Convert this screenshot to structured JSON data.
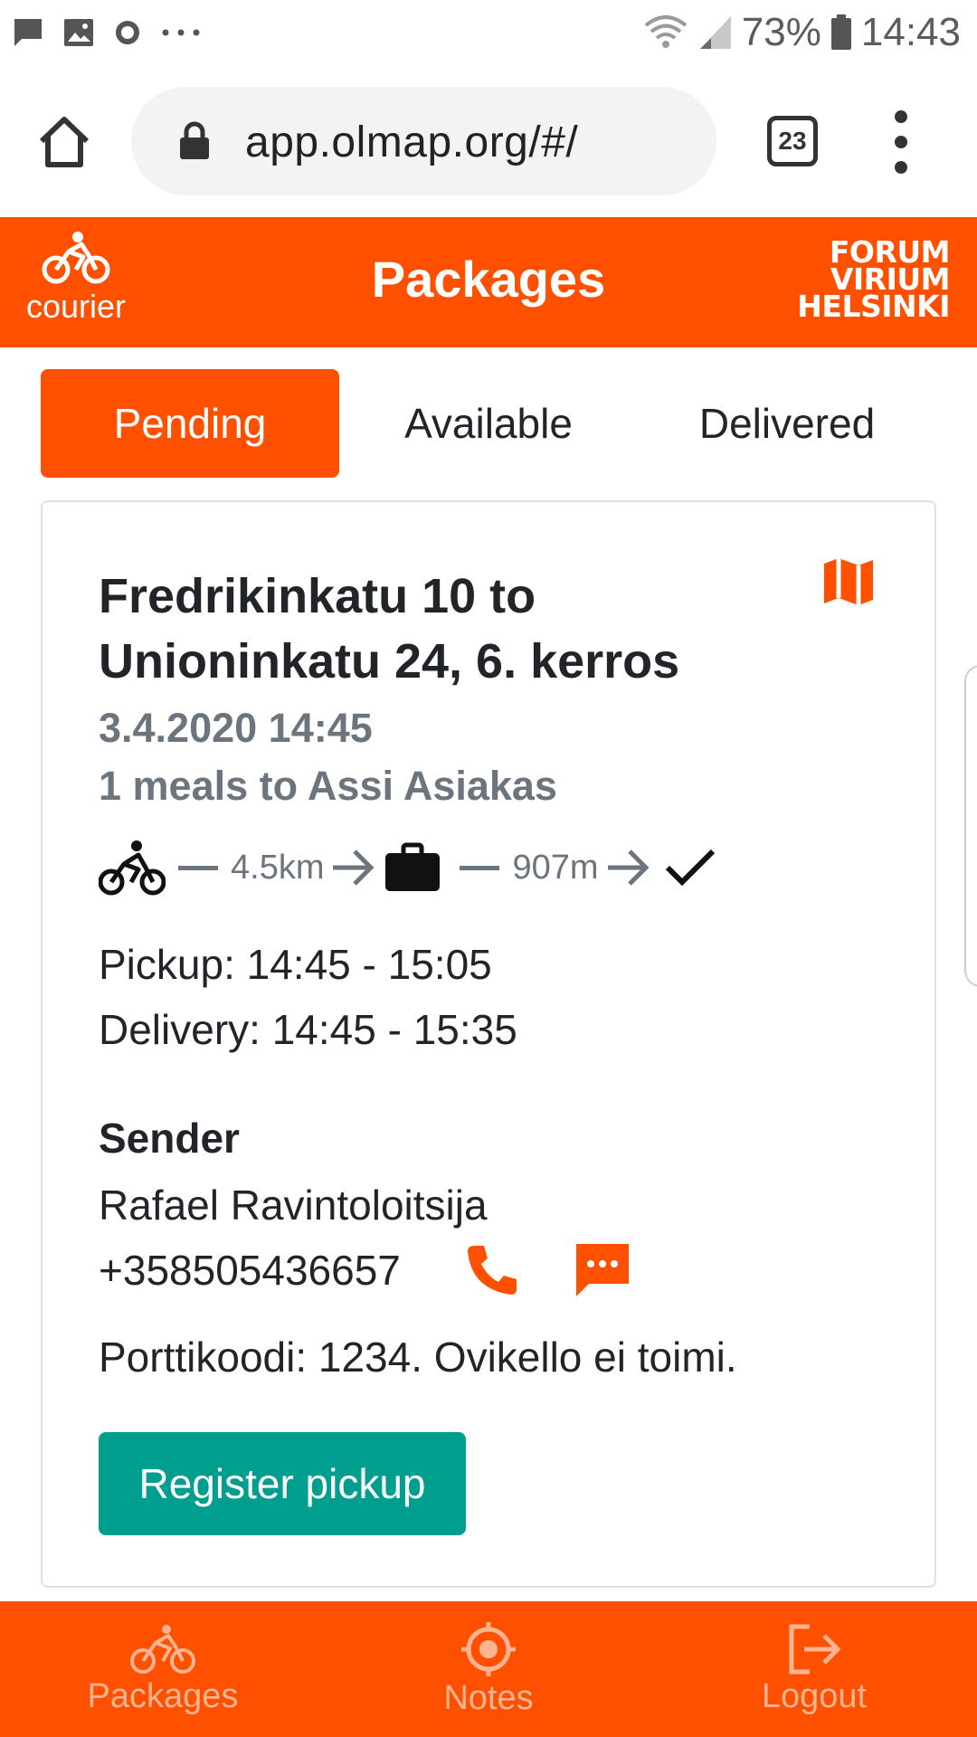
{
  "status_bar": {
    "battery_percent": "73%",
    "time": "14:43",
    "icons": [
      "chat-icon",
      "image-icon",
      "circle-icon",
      "more-dots-icon",
      "wifi-icon",
      "signal-icon",
      "battery-icon"
    ]
  },
  "browser": {
    "url": "app.olmap.org/#/",
    "tab_count": "23"
  },
  "header": {
    "brand_label": "courier",
    "title": "Packages",
    "partner_logo": [
      "FORUM",
      "VIRIUM",
      "HELSINKI"
    ]
  },
  "tabs": [
    {
      "label": "Pending",
      "active": true
    },
    {
      "label": "Available",
      "active": false
    },
    {
      "label": "Delivered",
      "active": false
    }
  ],
  "package": {
    "title": "Fredrikinkatu 10 to Unioninkatu 24, 6. kerros",
    "datetime": "3.4.2020 14:45",
    "meals": "1 meals to Assi Asiakas",
    "route": {
      "to_pickup_distance": "4.5km",
      "to_delivery_distance": "907m"
    },
    "pickup_window": "Pickup: 14:45 - 15:05",
    "delivery_window": "Delivery: 14:45 - 15:35",
    "sender_heading": "Sender",
    "sender_name": "Rafael Ravintoloitsija",
    "sender_phone": "+358505436657",
    "note": "Porttikoodi: 1234. Ovikello ei toimi.",
    "register_button": "Register pickup"
  },
  "bottom_nav": [
    {
      "label": "Packages",
      "icon": "bicycle-icon"
    },
    {
      "label": "Notes",
      "icon": "target-icon"
    },
    {
      "label": "Logout",
      "icon": "logout-icon"
    }
  ],
  "colors": {
    "brand_orange": "#ff5000",
    "button_teal": "#009e8f",
    "muted_text": "#6c757d"
  }
}
